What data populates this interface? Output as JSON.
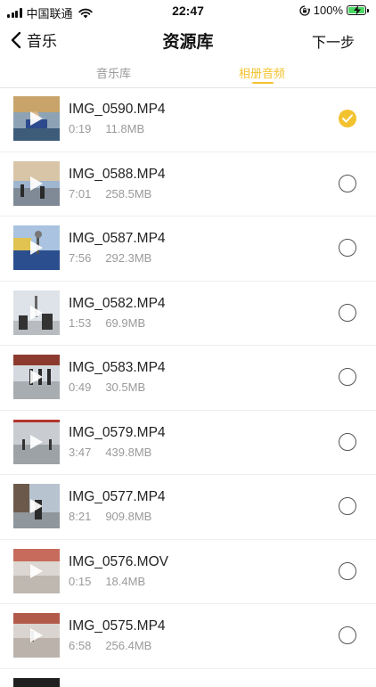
{
  "status_bar": {
    "carrier": "中国联通",
    "time": "22:47",
    "battery": "100%",
    "battery_level": 1.0,
    "icons": [
      "signal-icon",
      "wifi-icon",
      "rotation-lock-icon",
      "battery-charging-icon"
    ]
  },
  "nav": {
    "back_label": "音乐",
    "title": "资源库",
    "next_label": "下一步"
  },
  "tabs": [
    {
      "label": "音乐库",
      "active": false
    },
    {
      "label": "相册音频",
      "active": true
    }
  ],
  "colors": {
    "accent": "#f3c22f",
    "secondary_text": "#9a9a9a",
    "divider": "#ededed"
  },
  "videos": [
    {
      "name": "IMG_0590.MP4",
      "duration": "0:19",
      "size": "11.8MB",
      "selected": true
    },
    {
      "name": "IMG_0588.MP4",
      "duration": "7:01",
      "size": "258.5MB",
      "selected": false
    },
    {
      "name": "IMG_0587.MP4",
      "duration": "7:56",
      "size": "292.3MB",
      "selected": false
    },
    {
      "name": "IMG_0582.MP4",
      "duration": "1:53",
      "size": "69.9MB",
      "selected": false
    },
    {
      "name": "IMG_0583.MP4",
      "duration": "0:49",
      "size": "30.5MB",
      "selected": false
    },
    {
      "name": "IMG_0579.MP4",
      "duration": "3:47",
      "size": "439.8MB",
      "selected": false
    },
    {
      "name": "IMG_0577.MP4",
      "duration": "8:21",
      "size": "909.8MB",
      "selected": false
    },
    {
      "name": "IMG_0576.MOV",
      "duration": "0:15",
      "size": "18.4MB",
      "selected": false
    },
    {
      "name": "IMG_0575.MP4",
      "duration": "6:58",
      "size": "256.4MB",
      "selected": false
    }
  ]
}
